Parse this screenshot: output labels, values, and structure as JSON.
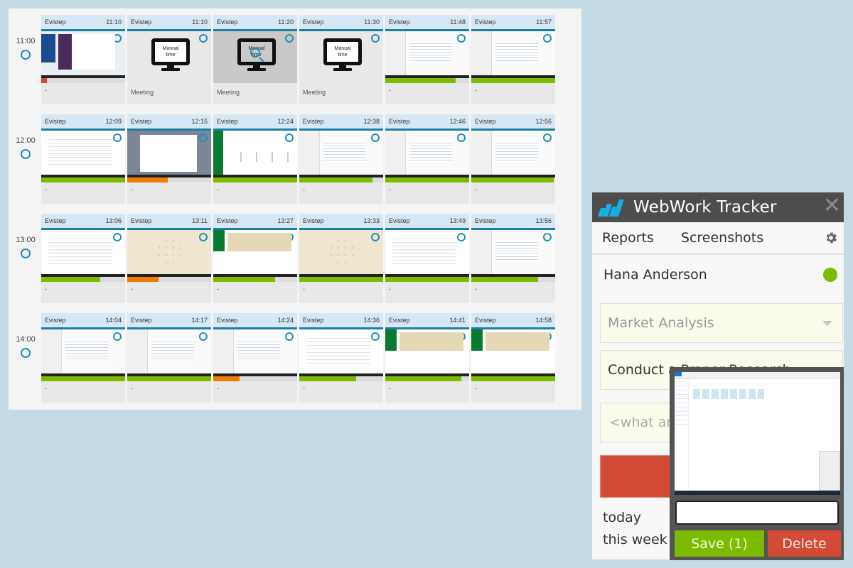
{
  "colors": {
    "accent": "#1c7fa0",
    "green": "#7cbb00",
    "orange": "#f07d00",
    "red": "#d34a36",
    "header_dark": "#4d4d4d"
  },
  "screenshots": {
    "rows": [
      {
        "hour": "11:00",
        "cards": [
          {
            "project": "Evistep",
            "time": "11:10",
            "type": "screen",
            "thumb": "slack",
            "activity": 0.07,
            "activity_color": "red",
            "note": "-"
          },
          {
            "project": "Evistep",
            "time": "11:10",
            "type": "manual",
            "manual_line1": "Manual",
            "manual_line2": "time",
            "note": "Meeting"
          },
          {
            "project": "Evistep",
            "time": "11:20",
            "type": "manual",
            "selected": true,
            "manual_line1": "Manual",
            "manual_line2": "time",
            "note": "Meeting"
          },
          {
            "project": "Evistep",
            "time": "11:30",
            "type": "manual",
            "manual_line1": "Manual",
            "manual_line2": "time",
            "note": "Meeting"
          },
          {
            "project": "Evistep",
            "time": "11:48",
            "type": "screen",
            "thumb": "code",
            "activity": 0.84,
            "activity_color": "green",
            "note": "-"
          },
          {
            "project": "Evistep",
            "time": "11:57",
            "type": "screen",
            "thumb": "code",
            "activity": 1.0,
            "activity_color": "green",
            "note": "-"
          }
        ]
      },
      {
        "hour": "12:00",
        "cards": [
          {
            "project": "Evistep",
            "time": "12:09",
            "type": "screen",
            "thumb": "web",
            "activity": 1.0,
            "activity_color": "green",
            "note": "-"
          },
          {
            "project": "Evistep",
            "time": "12:15",
            "type": "screen",
            "thumb": "gray",
            "activity": 0.48,
            "activity_color": "orange",
            "note": "-"
          },
          {
            "project": "Evistep",
            "time": "12:24",
            "type": "screen",
            "thumb": "dash",
            "activity": 1.0,
            "activity_color": "green",
            "note": "-"
          },
          {
            "project": "Evistep",
            "time": "12:38",
            "type": "screen",
            "thumb": "code",
            "activity": 0.87,
            "activity_color": "green",
            "note": "-"
          },
          {
            "project": "Evistep",
            "time": "12:46",
            "type": "screen",
            "thumb": "code",
            "activity": 1.0,
            "activity_color": "green",
            "note": "-"
          },
          {
            "project": "Evistep",
            "time": "12:56",
            "type": "screen",
            "thumb": "code",
            "activity": 0.98,
            "activity_color": "green",
            "note": "-"
          }
        ]
      },
      {
        "hour": "13:00",
        "cards": [
          {
            "project": "Evistep",
            "time": "13:06",
            "type": "screen",
            "thumb": "web",
            "activity": 0.7,
            "activity_color": "green",
            "note": "-"
          },
          {
            "project": "Evistep",
            "time": "13:11",
            "type": "screen",
            "thumb": "map",
            "activity": 0.37,
            "activity_color": "orange",
            "note": "-"
          },
          {
            "project": "Evistep",
            "time": "13:27",
            "type": "screen",
            "thumb": "green",
            "activity": 0.74,
            "activity_color": "green",
            "note": "-"
          },
          {
            "project": "Evistep",
            "time": "13:33",
            "type": "screen",
            "thumb": "map",
            "activity": 1.0,
            "activity_color": "green",
            "note": "-"
          },
          {
            "project": "Evistep",
            "time": "13:49",
            "type": "screen",
            "thumb": "web",
            "activity": 1.0,
            "activity_color": "green",
            "note": "-"
          },
          {
            "project": "Evistep",
            "time": "13:56",
            "type": "screen",
            "thumb": "code",
            "activity": 0.8,
            "activity_color": "green",
            "note": "-"
          }
        ]
      },
      {
        "hour": "14:00",
        "cards": [
          {
            "project": "Evistep",
            "time": "14:04",
            "type": "screen",
            "thumb": "code",
            "activity": 1.0,
            "activity_color": "green",
            "note": "-"
          },
          {
            "project": "Evistep",
            "time": "14:17",
            "type": "screen",
            "thumb": "code",
            "activity": 1.0,
            "activity_color": "green",
            "note": "-"
          },
          {
            "project": "Evistep",
            "time": "14:24",
            "type": "screen",
            "thumb": "code",
            "activity": 0.31,
            "activity_color": "orange",
            "note": "-"
          },
          {
            "project": "Evistep",
            "time": "14:36",
            "type": "screen",
            "thumb": "web",
            "activity": 0.68,
            "activity_color": "green",
            "note": "-"
          },
          {
            "project": "Evistep",
            "time": "14:41",
            "type": "screen",
            "thumb": "green",
            "activity": 0.91,
            "activity_color": "green",
            "note": "-"
          },
          {
            "project": "Evistep",
            "time": "14:58",
            "type": "screen",
            "thumb": "green",
            "activity": 1.0,
            "activity_color": "green",
            "note": "-"
          }
        ]
      }
    ]
  },
  "tracker": {
    "title": "WebWork Tracker",
    "close_icon": "close-icon",
    "nav": {
      "reports": "Reports",
      "screenshots": "Screenshots",
      "settings_icon": "gear-icon"
    },
    "user": {
      "name": "Hana Anderson",
      "status": "online"
    },
    "project_select": {
      "value": "Market Analysis"
    },
    "task_select": {
      "value": "Conduct a Proper Research"
    },
    "note_input": {
      "placeholder": "<what are"
    },
    "time_labels": {
      "today": "today",
      "this_week": "this week"
    }
  },
  "preview": {
    "note_value": "",
    "save_label": "Save (1)",
    "delete_label": "Delete"
  }
}
